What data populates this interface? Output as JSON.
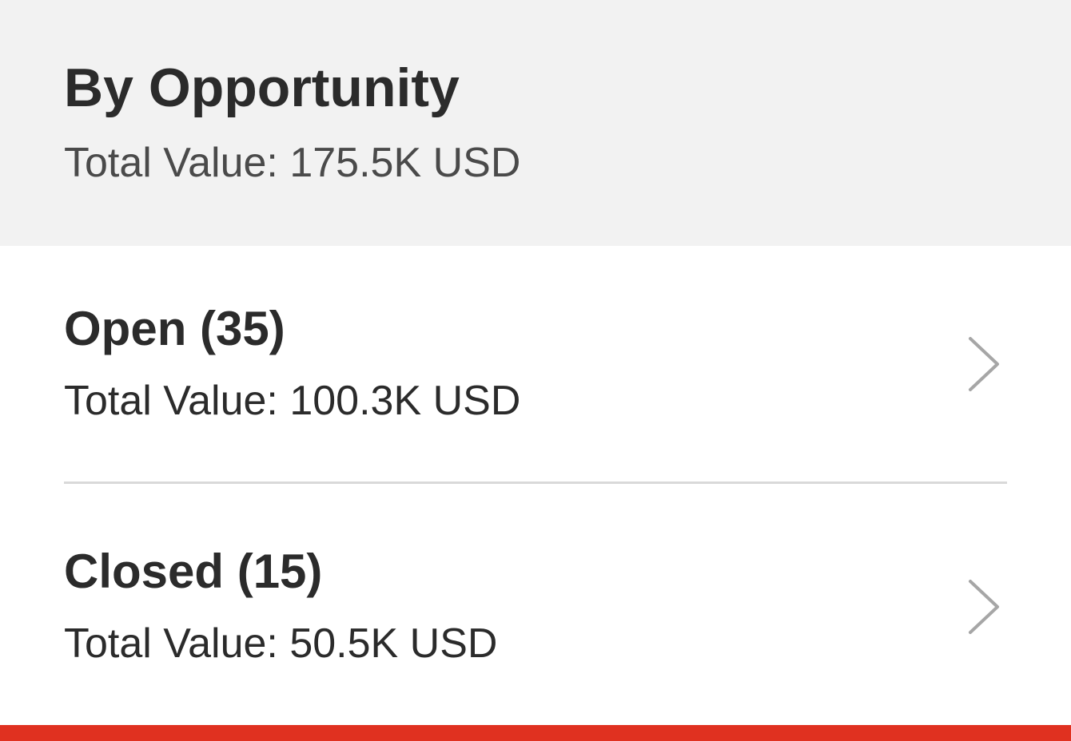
{
  "header": {
    "title": "By Opportunity",
    "total": "Total Value: 175.5K USD"
  },
  "rows": [
    {
      "title": "Open (35)",
      "total": "Total Value: 100.3K USD",
      "icon": "chevron-right-icon"
    },
    {
      "title": "Closed (15)",
      "total": "Total Value: 50.5K USD",
      "icon": "chevron-right-icon"
    }
  ],
  "colors": {
    "header_bg": "#f2f2f2",
    "accent": "#e03120",
    "chevron": "#a6a6a6",
    "divider": "#d9d9d9"
  }
}
